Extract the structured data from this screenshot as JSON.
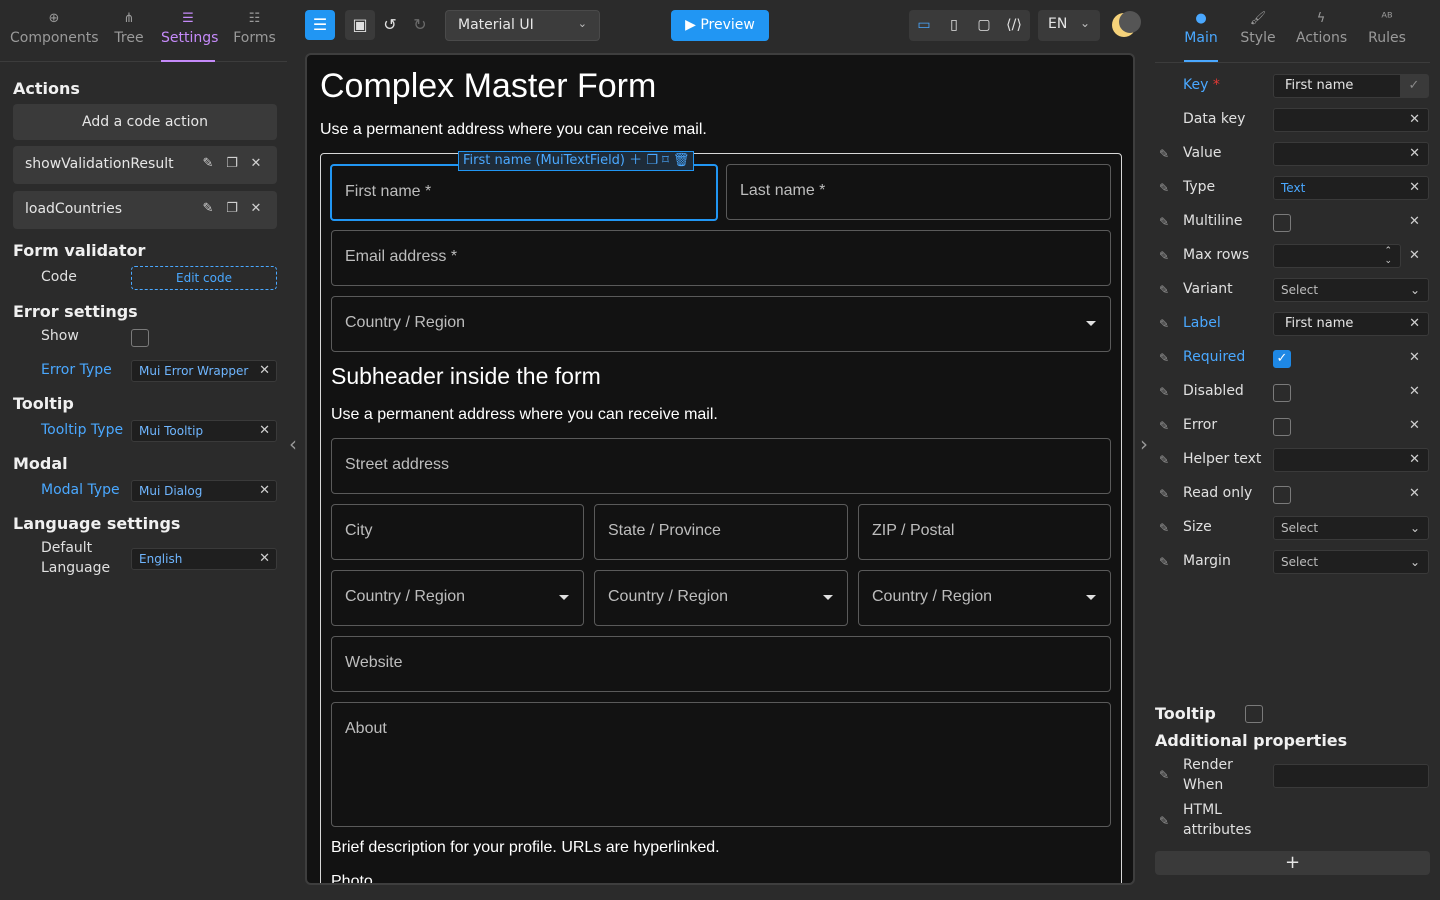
{
  "left_tabs": [
    {
      "label": "Components",
      "icon": "plus-circle-icon"
    },
    {
      "label": "Tree",
      "icon": "tree-icon"
    },
    {
      "label": "Settings",
      "icon": "sliders-icon"
    },
    {
      "label": "Forms",
      "icon": "list-icon"
    }
  ],
  "actions": {
    "title": "Actions",
    "add_label": "Add a code action",
    "items": [
      "showValidationResult",
      "loadCountries"
    ]
  },
  "form_validator": {
    "title": "Form validator",
    "code_label": "Code",
    "edit_label": "Edit code"
  },
  "error_settings": {
    "title": "Error settings",
    "show_label": "Show",
    "type_label": "Error Type",
    "type_value": "Mui Error Wrapper"
  },
  "tooltip": {
    "title": "Tooltip",
    "type_label": "Tooltip Type",
    "type_value": "Mui Tooltip"
  },
  "modal": {
    "title": "Modal",
    "type_label": "Modal Type",
    "type_value": "Mui Dialog"
  },
  "language": {
    "title": "Language settings",
    "default_label_1": "Default",
    "default_label_2": "Language",
    "value": "English"
  },
  "toolbar": {
    "theme_select": "Material UI",
    "preview_label": "Preview",
    "lang": "EN",
    "accent": "#2196f3"
  },
  "form": {
    "title": "Complex Master Form",
    "subtitle": "Use a permanent address where you can receive mail.",
    "selected_label": "First name (MuiTextField)",
    "first_name": "First name *",
    "last_name": "Last name *",
    "email": "Email address *",
    "country": "Country / Region",
    "subheader": "Subheader inside the form",
    "subheader_text": "Use a permanent address where you can receive mail.",
    "street": "Street address",
    "city": "City",
    "state": "State / Province",
    "zip": "ZIP / Postal",
    "country_a": "Country / Region",
    "country_b": "Country / Region",
    "country_c": "Country / Region",
    "website": "Website",
    "about": "About",
    "about_help": "Brief description for your profile. URLs are hyperlinked.",
    "photo": "Photo"
  },
  "right_tabs": [
    {
      "label": "Main",
      "icon": "circle-icon"
    },
    {
      "label": "Style",
      "icon": "brush-icon"
    },
    {
      "label": "Actions",
      "icon": "bolt-icon"
    },
    {
      "label": "Rules",
      "icon": "ab-icon"
    }
  ],
  "props": {
    "key_label": "Key",
    "key_required": "*",
    "key_value": "First name",
    "data_key": "Data key",
    "value": "Value",
    "type": "Type",
    "type_value": "Text",
    "multiline": "Multiline",
    "max_rows": "Max rows",
    "variant": "Variant",
    "variant_value": "Select",
    "label": "Label",
    "label_value": "First name",
    "required": "Required",
    "disabled": "Disabled",
    "error": "Error",
    "helper_text": "Helper text",
    "read_only": "Read only",
    "size": "Size",
    "size_value": "Select",
    "margin": "Margin",
    "margin_value": "Select",
    "tooltip": "Tooltip",
    "additional": "Additional properties",
    "render_1": "Render",
    "render_2": "When",
    "html_1": "HTML",
    "html_2": "attributes",
    "add": "+"
  }
}
